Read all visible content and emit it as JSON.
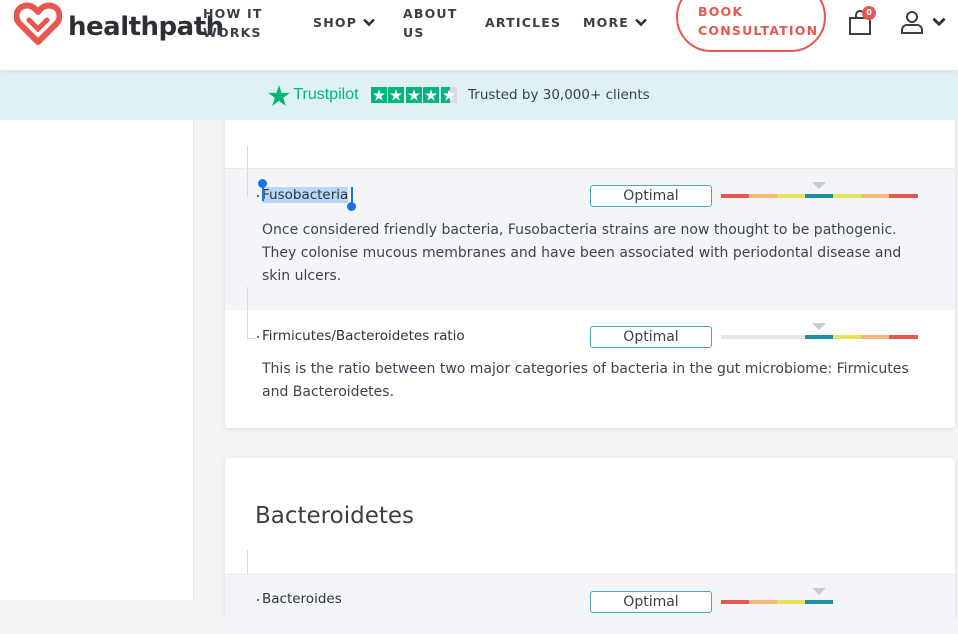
{
  "brand": {
    "name": "healthpath"
  },
  "nav": {
    "how_it_works_1": "HOW IT",
    "how_it_works_2": "WORKS",
    "shop": "SHOP",
    "about_1": "ABOUT",
    "about_2": "US",
    "articles": "ARTICLES",
    "more": "MORE",
    "book_1": "BOOK",
    "book_2": "CONSULTATION",
    "cart_count": "0"
  },
  "trustbar": {
    "brand": "Trustpilot",
    "rating_stars": 4.5,
    "text": "Trusted by 30,000+ clients"
  },
  "results": [
    {
      "name": "Fusobacteria",
      "status": "Optimal",
      "description": "Once considered friendly bacteria, Fusobacteria strains are now thought to be pathogenic. They colonise mucous membranes and have been associated with periodontal disease and skin ulcers.",
      "selected": true
    },
    {
      "name": "Firmicutes/Bacteroidetes ratio",
      "status": "Optimal",
      "description": "This is the ratio between two major categories of bacteria in the gut microbiome: Firmicutes and Bacteroidetes."
    }
  ],
  "section2": {
    "title": "Bacteroidetes",
    "first_row_name": "Bacteroides",
    "first_row_status": "Optimal"
  },
  "colors": {
    "accent": "#e8574f",
    "trustpilot_green": "#00b67a",
    "range_red": "#e8574f",
    "range_orange": "#f5b97a",
    "range_yellow": "#e6e35a",
    "range_teal": "#1f8fa8",
    "range_gray": "#e4e5e7"
  }
}
